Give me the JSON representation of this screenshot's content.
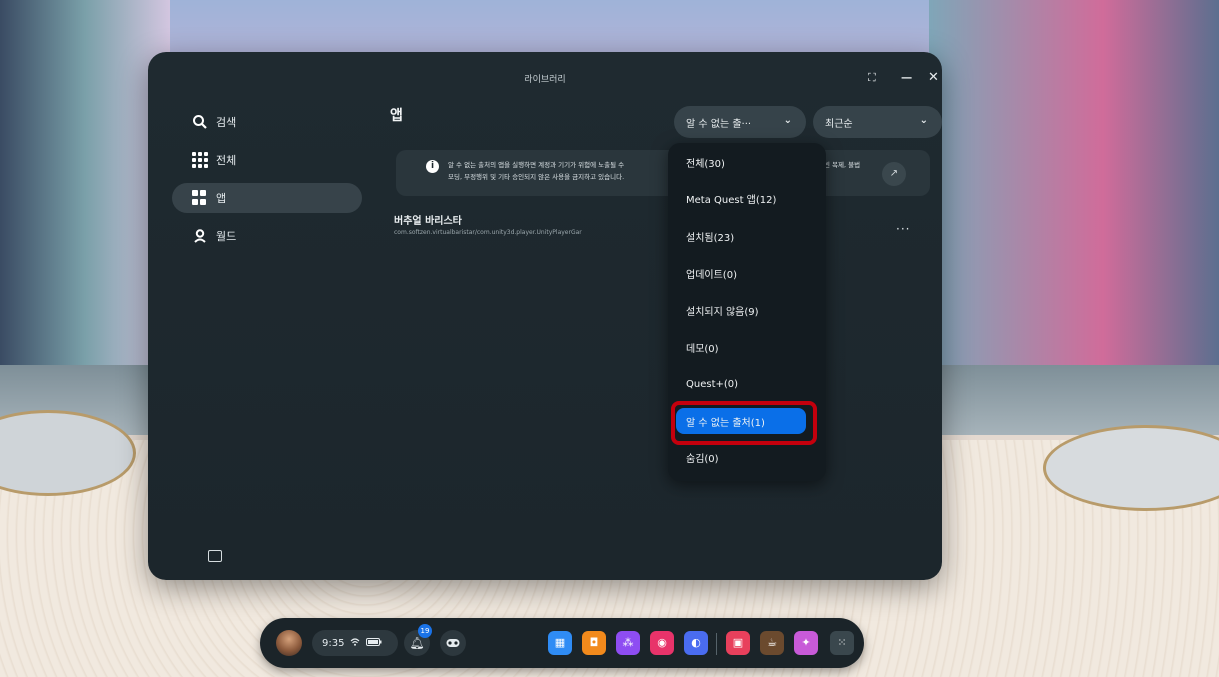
{
  "window": {
    "title": "라이브러리",
    "controls": {
      "resize": "⛶",
      "minimize": "−",
      "close": "✕"
    }
  },
  "sidebar": {
    "items": [
      {
        "label": "검색",
        "icon": "search-icon"
      },
      {
        "label": "전체",
        "icon": "grid-icon"
      },
      {
        "label": "앱",
        "icon": "apps-icon"
      },
      {
        "label": "월드",
        "icon": "world-icon"
      }
    ],
    "active_index": 2
  },
  "main": {
    "title": "앱",
    "filter_dropdown": {
      "value": "알 수 없는 출··· "
    },
    "sort_dropdown": {
      "value": "최근순"
    },
    "notice": {
      "line1": "알 수 없는 출처의 앱을 실행하면 계정과 기기가 위험에 노출될 수",
      "line2": "모딩, 부정행위 및 기타 승인되지 않은 사용을 금지하고 있습니다.",
      "tail": "빈 복제, 불법"
    },
    "app": {
      "name": "버추얼 바리스타",
      "package": "com.softzen.virtualbaristar/com.unity3d.player.UnityPlayerGar",
      "more": "···"
    }
  },
  "filter_menu": {
    "options": [
      "전체(30)",
      "Meta Quest 앱(12)",
      "설치됨(23)",
      "업데이트(0)",
      "설치되지 않음(9)",
      "데모(0)",
      "Quest+(0)",
      "알 수 없는 출처(1)",
      "숨김(0)"
    ],
    "selected_index": 7
  },
  "dock": {
    "time": "9:35",
    "notification_count": "19",
    "apps": [
      {
        "name": "store-app-icon",
        "color": "#2f8cf5"
      },
      {
        "name": "shop-app-icon",
        "color": "#f28a1c"
      },
      {
        "name": "people-app-icon",
        "color": "#8e4df2"
      },
      {
        "name": "camera-app-icon",
        "color": "#e8336a"
      },
      {
        "name": "browser-app-icon",
        "color": "#4a6cf0"
      },
      {
        "name": "events-app-icon",
        "color": "#e8405c"
      },
      {
        "name": "virtual-barista-app-icon",
        "color": "#6b4a2e"
      },
      {
        "name": "game-app-icon",
        "color": "#c85ad8"
      },
      {
        "name": "library-app-icon",
        "color": "#3a474d"
      }
    ]
  }
}
